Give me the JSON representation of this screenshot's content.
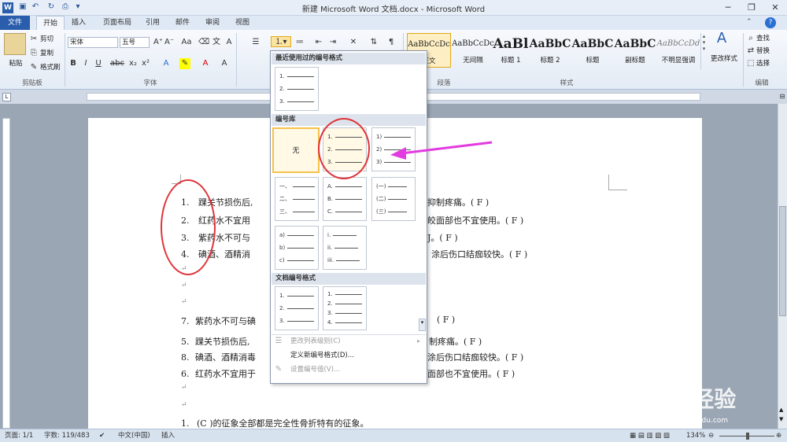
{
  "window": {
    "title": "新建 Microsoft Word 文档.docx - Microsoft Word",
    "app_icon": "W"
  },
  "tabs": [
    "文件",
    "开始",
    "插入",
    "页面布局",
    "引用",
    "邮件",
    "审阅",
    "视图"
  ],
  "clipboard": {
    "paste": "粘贴",
    "cut": "剪切",
    "copy": "复制",
    "format_painter": "格式刷",
    "group": "剪贴板"
  },
  "font": {
    "name": "宋体",
    "size": "五号",
    "group": "字体"
  },
  "paragraph": {
    "group": "段落"
  },
  "styles": {
    "group": "样式",
    "items": [
      {
        "preview": "AaBbCcDc",
        "name": "正文"
      },
      {
        "preview": "AaBbCcDc",
        "name": "无间隔"
      },
      {
        "preview": "AaBl",
        "name": "标题 1"
      },
      {
        "preview": "AaBbC",
        "name": "标题 2"
      },
      {
        "preview": "AaBbC",
        "name": "标题"
      },
      {
        "preview": "AaBbC",
        "name": "副标题"
      },
      {
        "preview": "AaBbCcDd",
        "name": "不明显强调"
      }
    ],
    "change_styles": "更改样式"
  },
  "editing": {
    "find": "查找",
    "replace": "替换",
    "select": "选择",
    "group": "编辑"
  },
  "dropdown": {
    "recent_header": "最近使用过的编号格式",
    "library_header": "编号库",
    "document_header": "文档编号格式",
    "none_label": "无",
    "recent": [
      [
        "1.",
        "2.",
        "3."
      ]
    ],
    "library": [
      [
        "1.",
        "2.",
        "3."
      ],
      [
        "1)",
        "2)",
        "3)"
      ],
      [
        "一、",
        "二、",
        "三、"
      ],
      [
        "A.",
        "B.",
        "C."
      ],
      [
        "(一)",
        "(二)",
        "(三)"
      ],
      [
        "a)",
        "b)",
        "c)"
      ],
      [
        "i.",
        "ii.",
        "iii."
      ]
    ],
    "document": [
      [
        "1.",
        "2.",
        "3."
      ],
      [
        "1.",
        "2.",
        "3.",
        "4."
      ]
    ],
    "menu": [
      {
        "label": "更改列表级别(C)",
        "enabled": false
      },
      {
        "label": "定义新编号格式(D)...",
        "enabled": true
      },
      {
        "label": "设置编号值(V)...",
        "enabled": false
      }
    ]
  },
  "document": {
    "lines": [
      {
        "num": "1.",
        "left": "踝关节损伤后,",
        "right": "抑制疼痛。( F )"
      },
      {
        "num": "2.",
        "left": "红药水不宜用",
        "right": "皎面部也不宜使用。( F )"
      },
      {
        "num": "3.",
        "left": "紫药水不可与",
        "right": "J。( F )"
      },
      {
        "num": "4.",
        "left": "碘酒、酒精消",
        "right": "涂后伤口结痂较快。( F )"
      },
      {
        "num": "7.",
        "left": "紫药水不可与碘",
        "right": "( F )"
      },
      {
        "num": "5.",
        "left": "踝关节损伤后,",
        "right": "制疼痛。( F )"
      },
      {
        "num": "8.",
        "left": "碘酒、酒精消毒",
        "right": "涂后伤口结痂较快。( F )"
      },
      {
        "num": "6.",
        "left": "红药水不宜用于",
        "right": "面部也不宜使用。( F )"
      },
      {
        "num": "1.",
        "left": "(C )的征象全部都是完全性骨折特有的征象。",
        "right": ""
      }
    ],
    "paragraph_mark": "↵"
  },
  "status": {
    "page": "页面: 1/1",
    "words": "字数: 119/483",
    "lang": "中文(中国)",
    "mode": "插入",
    "zoom": "134%"
  },
  "watermark": {
    "brand": "Bai du 经验",
    "url": "jingyan.baidu.com"
  },
  "colors": {
    "accent": "#2a5dac",
    "highlight_circle": "#e0343a",
    "arrow": "#e23be0",
    "selected_tile": "#f5c24a"
  }
}
